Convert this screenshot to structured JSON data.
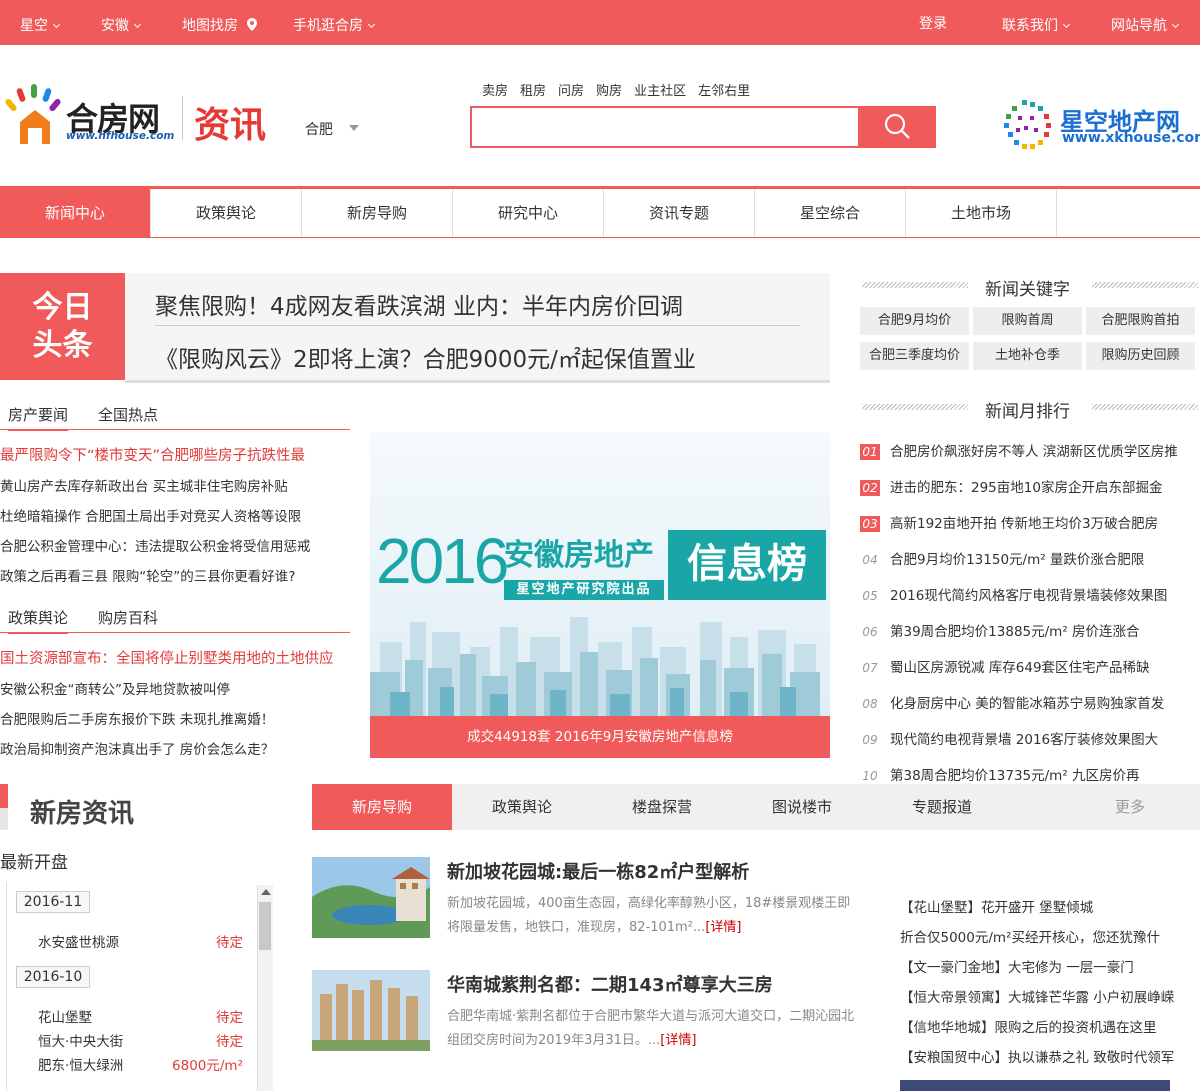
{
  "topbar": {
    "items": [
      "星空",
      "安徽",
      "地图找房",
      "手机逛合房"
    ],
    "login": "登录",
    "contact": "联系我们",
    "site_nav": "网站导航"
  },
  "header": {
    "logo_text": "合房网",
    "logo_url_text": "www.hfhouse.com",
    "section": "资讯",
    "city": "合肥",
    "search_tabs": [
      "卖房",
      "租房",
      "问房",
      "购房",
      "业主社区",
      "左邻右里"
    ],
    "search_placeholder": "",
    "partner_logo": "星空地产网",
    "partner_url": "www.xkhouse.com"
  },
  "nav": [
    "新闻中心",
    "政策舆论",
    "新房导购",
    "研究中心",
    "资讯专题",
    "星空综合",
    "土地市场"
  ],
  "headline": {
    "label_line1": "今日",
    "label_line2": "头条",
    "items": [
      "聚焦限购！4成网友看跌滨湖 业内：半年内房价回调",
      "《限购风云》2即将上演？合肥9000元/㎡起保值置业"
    ]
  },
  "list1": {
    "tabs": [
      "房产要闻",
      "全国热点"
    ],
    "items": [
      "最严限购令下“楼市变天”合肥哪些房子抗跌性最",
      "黄山房产去库存新政出台 买主城非住宅购房补贴",
      "杜绝暗箱操作 合肥国土局出手对竞买人资格等设限",
      "合肥公积金管理中心：违法提取公积金将受信用惩戒",
      "政策之后再看三县 限购“轮空”的三县你更看好谁?"
    ]
  },
  "list2": {
    "tabs": [
      "政策舆论",
      "购房百科"
    ],
    "items": [
      "国土资源部宣布：全国将停止别墅类用地的土地供应",
      "安徽公积金“商转公”及异地贷款被叫停",
      "合肥限购后二手房东报价下跌 未现扎推离婚！",
      "政治局抑制资产泡沫真出手了 房价会怎么走？"
    ]
  },
  "banner": {
    "year": "2016",
    "title": "安徽房地产",
    "badge": "信息榜",
    "sub": "星空地产研究院出品",
    "caption": "成交44918套 2016年9月安徽房地产信息榜"
  },
  "keywords": {
    "title": "新闻关键字",
    "items": [
      "合肥9月均价",
      "限购首周",
      "合肥限购首拍",
      "合肥三季度均价",
      "土地补仓季",
      "限购历史回顾"
    ]
  },
  "ranking": {
    "title": "新闻月排行",
    "items": [
      {
        "n": "01",
        "text": "合肥房价飙涨好房不等人 滨湖新区优质学区房推"
      },
      {
        "n": "02",
        "text": "进击的肥东：295亩地10家房企开启东部掘金"
      },
      {
        "n": "03",
        "text": "高新192亩地开拍 传新地王均价3万破合肥房"
      },
      {
        "n": "04",
        "text": "合肥9月均价13150元/m² 量跌价涨合肥限"
      },
      {
        "n": "05",
        "text": "2016现代简约风格客厅电视背景墙装修效果图"
      },
      {
        "n": "06",
        "text": "第39周合肥均价13885元/m² 房价连涨合"
      },
      {
        "n": "07",
        "text": "蜀山区房源锐减 库存649套区住宅产品稀缺"
      },
      {
        "n": "08",
        "text": "化身厨房中心 美的智能冰箱苏宁易购独家首发"
      },
      {
        "n": "09",
        "text": "现代简约电视背景墙 2016客厅装修效果图大"
      },
      {
        "n": "10",
        "text": "第38周合肥均价13735元/m² 九区房价再"
      }
    ]
  },
  "newhouse": {
    "title": "新房资讯",
    "latest": "最新开盘",
    "groups": [
      {
        "date": "2016-11",
        "items": [
          {
            "name": "水安盛世桃源",
            "status": "待定"
          }
        ]
      },
      {
        "date": "2016-10",
        "items": [
          {
            "name": "花山堡墅",
            "status": "待定"
          },
          {
            "name": "恒大·中央大街",
            "status": "待定"
          },
          {
            "name": "肥东·恒大绿洲",
            "status": "6800元/m²"
          }
        ]
      }
    ],
    "tabs": [
      "新房导购",
      "政策舆论",
      "楼盘探营",
      "图说楼市",
      "专题报道"
    ],
    "more": "更多",
    "news": [
      {
        "title": "新加坡花园城:最后一栋82㎡户型解析",
        "desc": "新加坡花园城，400亩生态园，高绿化率醇熟小区，18#楼景观楼王即将限量发售，地铁口，准现房，82-101m²...",
        "more": "[详情]"
      },
      {
        "title": "华南城紫荆名都：二期143㎡尊享大三房",
        "desc": "合肥华南城·紫荆名都位于合肥市繁华大道与派河大道交口，二期沁园北组团交房时间为2019年3月31日。...",
        "more": "[详情]"
      }
    ],
    "right_list": [
      "【花山堡墅】花开盛开 堡墅倾城",
      "折合仅5000元/m²买经开核心，您还犹豫什",
      "【文一豪门金地】大宅修为 一层一豪门",
      "【恒大帝景领寓】大城锋芒华露 小户初展峥嵘",
      "【信地华地城】限购之后的投资机遇在这里",
      "【安粮国贸中心】执以谦恭之礼 致敬时代领军"
    ]
  },
  "colors": {
    "accent": "#f05a5a",
    "teal": "#1aa6a6"
  }
}
